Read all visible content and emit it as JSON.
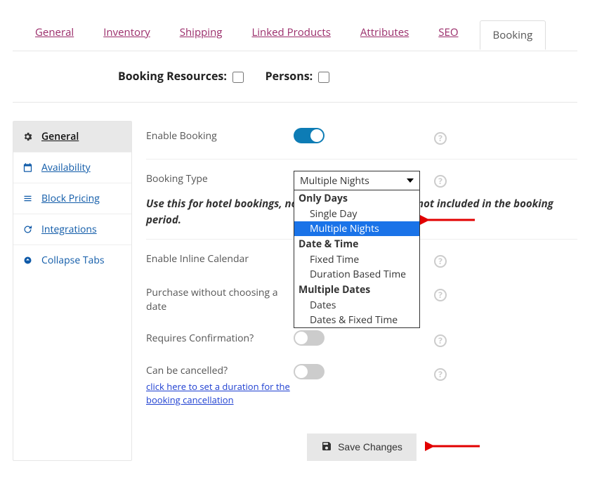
{
  "tabs": {
    "general": "General",
    "inventory": "Inventory",
    "shipping": "Shipping",
    "linked": "Linked Products",
    "attributes": "Attributes",
    "seo": "SEO",
    "booking": "Booking"
  },
  "checkrow": {
    "resources_label": "Booking Resources:",
    "persons_label": "Persons:"
  },
  "sidebar": {
    "general": "General",
    "availability": "Availability",
    "block_pricing": "Block Pricing",
    "integrations": "Integrations",
    "collapse": "Collapse Tabs"
  },
  "form": {
    "enable_booking": "Enable Booking",
    "booking_type": "Booking Type",
    "booking_type_value": "Multiple Nights",
    "booking_type_note": "Use this for hotel bookings, note that check-out day is not included in the booking period.",
    "inline_calendar": "Enable Inline Calendar",
    "purchase_no_date": "Purchase without choosing a date",
    "requires_confirmation": "Requires Confirmation?",
    "can_be_cancelled": "Can be cancelled?",
    "cancel_link": "click here to set a duration for the booking cancellation",
    "save_btn": "Save Changes"
  },
  "dropdown": {
    "group1": "Only Days",
    "g1_opt1": "Single Day",
    "g1_opt2": "Multiple Nights",
    "group2": "Date & Time",
    "g2_opt1": "Fixed Time",
    "g2_opt2": "Duration Based Time",
    "group3": "Multiple Dates",
    "g3_opt1": "Dates",
    "g3_opt2": "Dates & Fixed Time"
  }
}
